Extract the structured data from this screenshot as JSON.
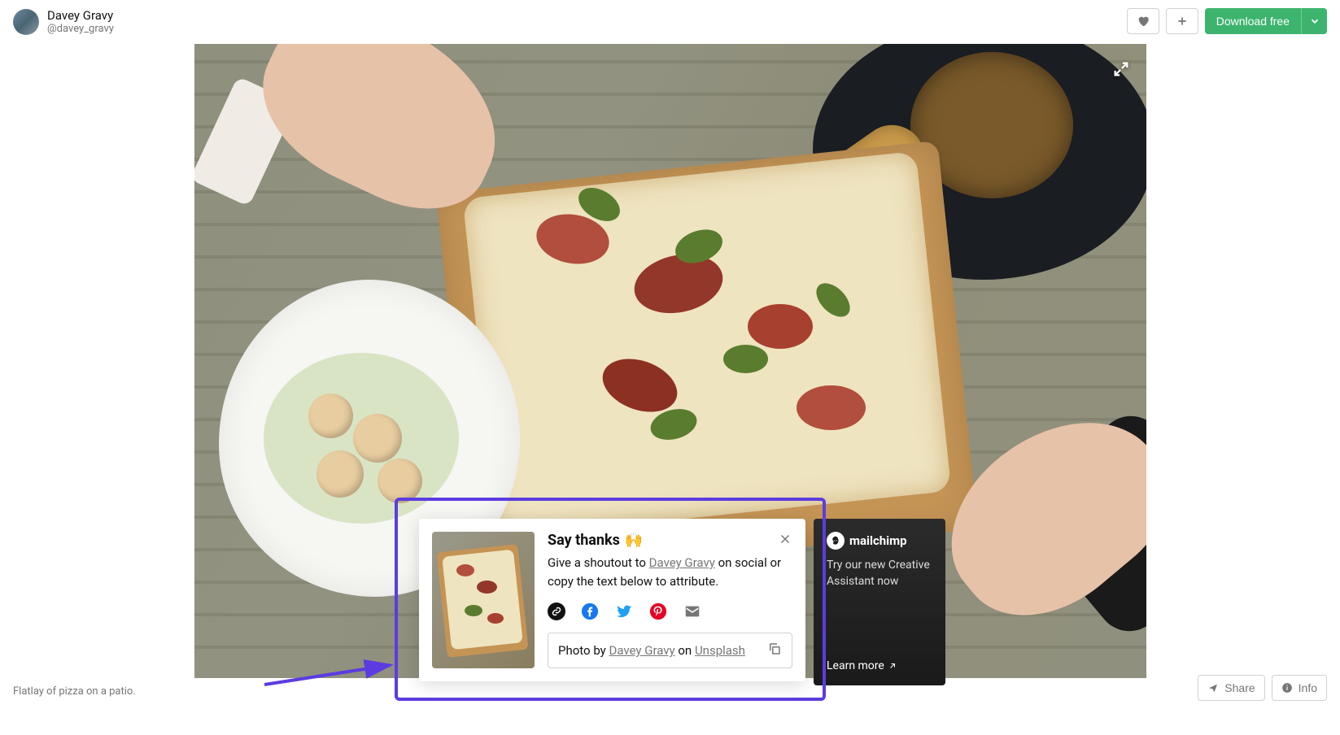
{
  "author": {
    "name": "Davey Gravy",
    "handle": "@davey_gravy"
  },
  "actions": {
    "download_label": "Download free"
  },
  "caption": "Flatlay of pizza on a patio.",
  "footer": {
    "share_label": "Share",
    "info_label": "Info"
  },
  "thanks": {
    "title": "Say thanks",
    "emoji": "🙌",
    "desc_prefix": "Give a shoutout to ",
    "desc_author": "Davey Gravy",
    "desc_suffix": " on social or copy the text below to attribute.",
    "attrib_prefix": "Photo by ",
    "attrib_author": "Davey Gravy",
    "attrib_mid": " on ",
    "attrib_site": "Unsplash"
  },
  "promo": {
    "brand": "mailchimp",
    "text": "Try our new Creative Assistant now",
    "cta": "Learn more"
  }
}
